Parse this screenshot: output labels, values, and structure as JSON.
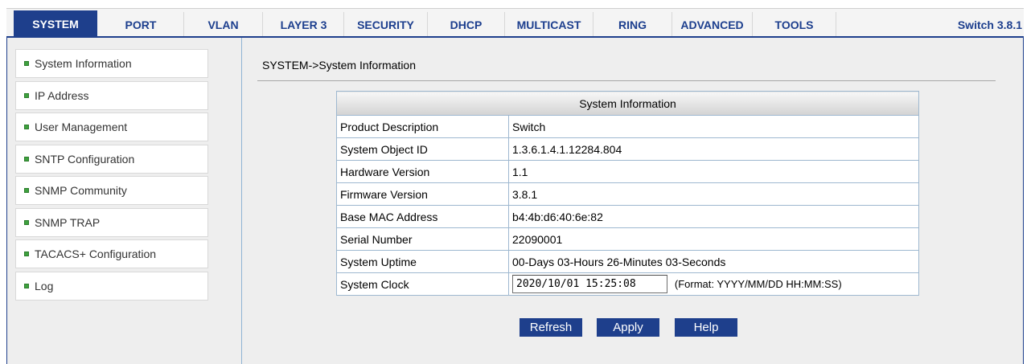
{
  "nav": {
    "tabs": [
      {
        "label": "SYSTEM"
      },
      {
        "label": "PORT"
      },
      {
        "label": "VLAN"
      },
      {
        "label": "LAYER 3"
      },
      {
        "label": "SECURITY"
      },
      {
        "label": "DHCP"
      },
      {
        "label": "MULTICAST"
      },
      {
        "label": "RING"
      },
      {
        "label": "ADVANCED"
      },
      {
        "label": "TOOLS"
      }
    ],
    "active_tab": "SYSTEM",
    "version": "Switch 3.8.1"
  },
  "sidebar": {
    "items": [
      {
        "label": "System Information"
      },
      {
        "label": "IP Address"
      },
      {
        "label": "User Management"
      },
      {
        "label": "SNTP Configuration"
      },
      {
        "label": "SNMP Community"
      },
      {
        "label": "SNMP TRAP"
      },
      {
        "label": "TACACS+ Configuration"
      },
      {
        "label": "Log"
      }
    ]
  },
  "main": {
    "breadcrumb": "SYSTEM->System Information",
    "table_title": "System Information",
    "rows": [
      {
        "label": "Product Description",
        "value": "Switch"
      },
      {
        "label": "System Object ID",
        "value": "1.3.6.1.4.1.12284.804"
      },
      {
        "label": "Hardware Version",
        "value": "1.1"
      },
      {
        "label": "Firmware Version",
        "value": "3.8.1"
      },
      {
        "label": "Base MAC Address",
        "value": "b4:4b:d6:40:6e:82"
      },
      {
        "label": "Serial Number",
        "value": "22090001"
      },
      {
        "label": "System Uptime",
        "value": "00-Days 03-Hours 26-Minutes 03-Seconds"
      }
    ],
    "clock": {
      "label": "System Clock",
      "value": "2020/10/01 15:25:08",
      "format_note": "(Format: YYYY/MM/DD HH:MM:SS)"
    },
    "buttons": {
      "refresh": "Refresh",
      "apply": "Apply",
      "help": "Help"
    }
  },
  "colors": {
    "nav_active_bg": "#1e3f8c",
    "nav_text": "#1d3f8e",
    "button_bg": "#1e3f8c",
    "bullet": "#3ea13e"
  }
}
